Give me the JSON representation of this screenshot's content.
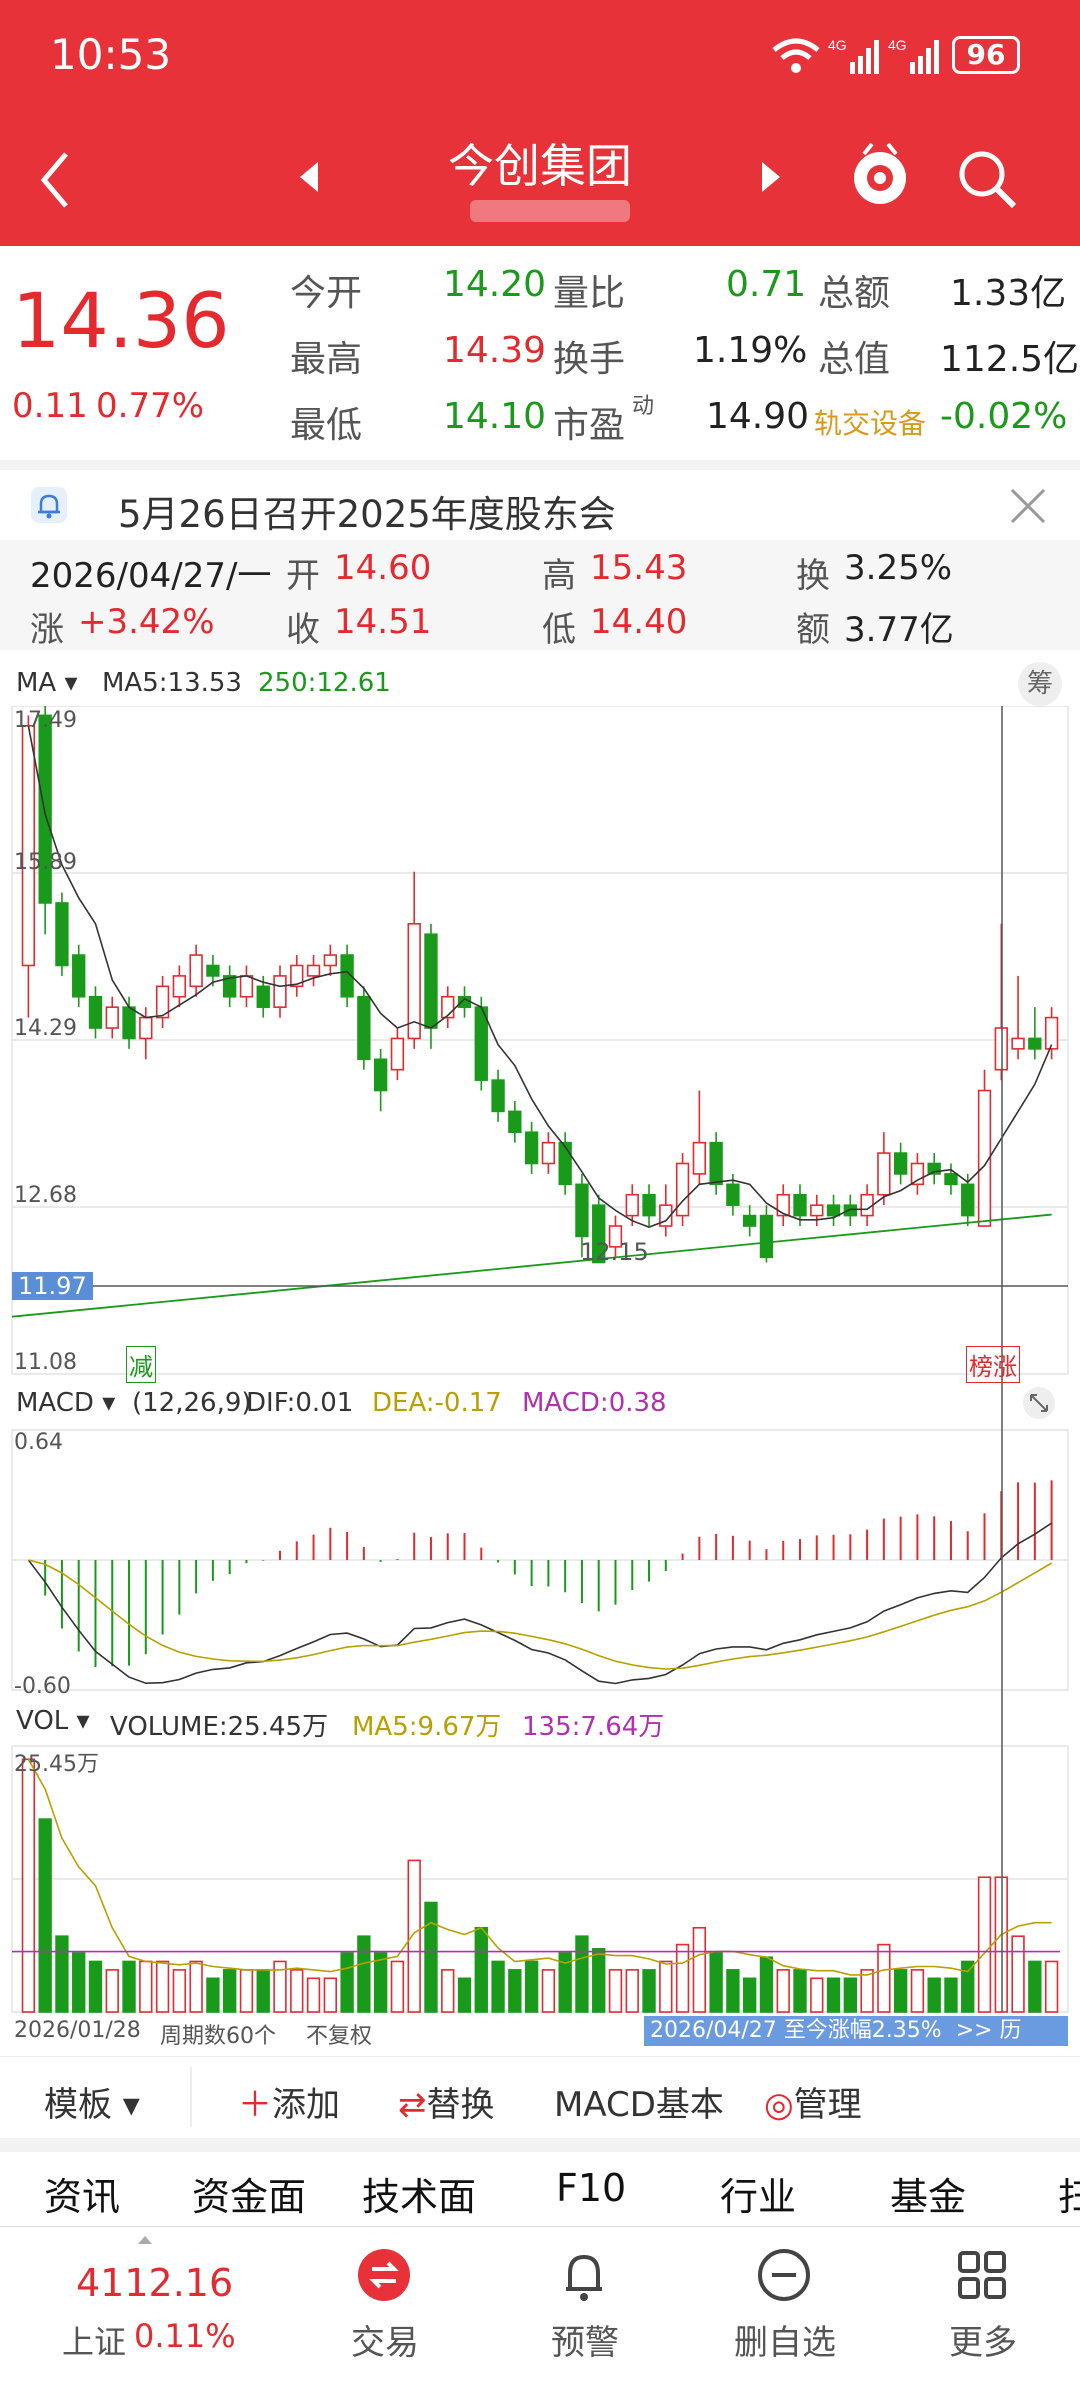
{
  "status": {
    "time": "10:53",
    "battery": "96",
    "net1": "4G",
    "net2": "4G"
  },
  "header": {
    "title": "今创集团"
  },
  "quote": {
    "price": "14.36",
    "change": "0.11",
    "pct": "0.77%",
    "rows": [
      {
        "l1": "今开",
        "v1": "14.20",
        "l2": "量比",
        "v2": "0.71",
        "l3": "总额",
        "v3": "1.33亿"
      },
      {
        "l1": "最高",
        "v1": "14.39",
        "l2": "换手",
        "v2": "1.19%",
        "l3": "总值",
        "v3": "112.5亿"
      },
      {
        "l1": "最低",
        "v1": "14.10",
        "l2": "市盈",
        "l2sup": "动",
        "v2": "14.90",
        "l3": "轨交设备",
        "v3": "-0.02%"
      }
    ]
  },
  "notice": {
    "text": "5月26日召开2025年度股东会"
  },
  "detail": {
    "date": "2026/04/27/一",
    "open_l": "开",
    "open": "14.60",
    "high_l": "高",
    "high": "15.43",
    "turn_l": "换",
    "turn": "3.25%",
    "chg_l": "涨",
    "chg": "+3.42%",
    "close_l": "收",
    "close": "14.51",
    "low_l": "低",
    "low": "14.40",
    "amt_l": "额",
    "amt": "3.77亿"
  },
  "kline": {
    "ma_label": "MA",
    "ma5": "MA5:13.53",
    "ma250": "250:12.61",
    "chip_btn": "筹",
    "y_ticks": [
      "17.49",
      "15.89",
      "14.29",
      "12.68",
      "11.08"
    ],
    "cursor_price": "11.97",
    "low_mark": "12.15",
    "tag_left": "减",
    "tag_right": "榜涨"
  },
  "macd": {
    "label": "MACD",
    "params": "(12,26,9)",
    "dif": "DIF:0.01",
    "dea": "DEA:-0.17",
    "macd": "MACD:0.38",
    "top": "0.64",
    "bottom": "-0.60"
  },
  "vol": {
    "label": "VOL",
    "volume": "VOLUME:25.45万",
    "ma5": "MA5:9.67万",
    "ma135": "135:7.64万",
    "top": "25.45万"
  },
  "footer_info": {
    "start": "2026/01/28",
    "period": "周期数60个",
    "adj": "不复权",
    "range": "2026/04/27 至今涨幅2.35%",
    "hist": ">> 历"
  },
  "toolbar": {
    "template": "模板",
    "add": "添加",
    "replace": "替换",
    "macd_basic": "MACD基本",
    "manage": "管理"
  },
  "tabs": [
    "资讯",
    "资金面",
    "技术面",
    "F10",
    "行业",
    "基金",
    "扫"
  ],
  "bottom": {
    "index_val": "4112.16",
    "index_name": "上证",
    "index_pct": "0.11%",
    "trade": "交易",
    "alert": "预警",
    "del": "删自选",
    "more": "更多"
  },
  "colors": {
    "up": "#e42a2f",
    "down": "#1a9a1a",
    "brand": "#e8323a"
  },
  "chart_data": {
    "type": "candlestick",
    "candles": [
      [
        15.0,
        17.3,
        17.4,
        14.5
      ],
      [
        17.4,
        15.6,
        17.49,
        15.3
      ],
      [
        15.6,
        15.0,
        15.7,
        14.9
      ],
      [
        15.1,
        14.7,
        15.2,
        14.6
      ],
      [
        14.7,
        14.4,
        14.8,
        14.3
      ],
      [
        14.4,
        14.6,
        14.7,
        14.3
      ],
      [
        14.6,
        14.3,
        14.7,
        14.2
      ],
      [
        14.3,
        14.5,
        14.6,
        14.1
      ],
      [
        14.5,
        14.8,
        14.9,
        14.4
      ],
      [
        14.7,
        14.9,
        15.0,
        14.6
      ],
      [
        14.8,
        15.1,
        15.2,
        14.7
      ],
      [
        15.0,
        14.9,
        15.1,
        14.8
      ],
      [
        14.9,
        14.7,
        15.0,
        14.6
      ],
      [
        14.7,
        14.9,
        15.0,
        14.6
      ],
      [
        14.8,
        14.6,
        14.9,
        14.5
      ],
      [
        14.6,
        14.9,
        15.0,
        14.5
      ],
      [
        14.8,
        15.0,
        15.1,
        14.7
      ],
      [
        14.9,
        15.0,
        15.1,
        14.8
      ],
      [
        15.0,
        15.1,
        15.2,
        14.9
      ],
      [
        15.1,
        14.7,
        15.2,
        14.6
      ],
      [
        14.7,
        14.1,
        14.8,
        14.0
      ],
      [
        14.1,
        13.8,
        14.2,
        13.6
      ],
      [
        14.0,
        14.3,
        14.4,
        13.9
      ],
      [
        14.3,
        15.4,
        15.9,
        14.2
      ],
      [
        15.3,
        14.4,
        15.4,
        14.2
      ],
      [
        14.5,
        14.7,
        14.8,
        14.4
      ],
      [
        14.7,
        14.6,
        14.8,
        14.5
      ],
      [
        14.6,
        13.9,
        14.7,
        13.8
      ],
      [
        13.9,
        13.6,
        14.0,
        13.5
      ],
      [
        13.6,
        13.4,
        13.7,
        13.3
      ],
      [
        13.4,
        13.1,
        13.5,
        13.0
      ],
      [
        13.1,
        13.3,
        13.4,
        13.0
      ],
      [
        13.3,
        12.9,
        13.4,
        12.8
      ],
      [
        12.9,
        12.4,
        13.0,
        12.2
      ],
      [
        12.7,
        12.15,
        12.8,
        12.15
      ],
      [
        12.3,
        12.5,
        12.6,
        12.2
      ],
      [
        12.6,
        12.8,
        12.9,
        12.5
      ],
      [
        12.8,
        12.6,
        12.9,
        12.5
      ],
      [
        12.5,
        12.7,
        12.9,
        12.4
      ],
      [
        12.6,
        13.1,
        13.2,
        12.5
      ],
      [
        13.0,
        13.3,
        13.8,
        12.9
      ],
      [
        13.3,
        12.9,
        13.4,
        12.8
      ],
      [
        12.9,
        12.7,
        13.0,
        12.6
      ],
      [
        12.6,
        12.5,
        12.7,
        12.4
      ],
      [
        12.6,
        12.2,
        12.7,
        12.15
      ],
      [
        12.6,
        12.8,
        12.9,
        12.5
      ],
      [
        12.8,
        12.6,
        12.9,
        12.5
      ],
      [
        12.6,
        12.7,
        12.8,
        12.5
      ],
      [
        12.7,
        12.6,
        12.8,
        12.5
      ],
      [
        12.7,
        12.6,
        12.8,
        12.5
      ],
      [
        12.6,
        12.8,
        12.9,
        12.5
      ],
      [
        12.8,
        13.2,
        13.4,
        12.7
      ],
      [
        13.2,
        13.0,
        13.3,
        12.9
      ],
      [
        12.9,
        13.1,
        13.2,
        12.8
      ],
      [
        13.1,
        13.0,
        13.2,
        12.9
      ],
      [
        13.0,
        12.9,
        13.1,
        12.8
      ],
      [
        12.9,
        12.6,
        13.0,
        12.5
      ],
      [
        12.5,
        13.8,
        14.0,
        12.5
      ],
      [
        14.0,
        14.4,
        15.4,
        13.9
      ],
      [
        14.2,
        14.3,
        14.9,
        14.1
      ],
      [
        14.3,
        14.2,
        14.6,
        14.1
      ],
      [
        14.2,
        14.5,
        14.6,
        14.1
      ]
    ],
    "ma5_dir": "up",
    "y_range": [
      11.08,
      17.49
    ]
  }
}
